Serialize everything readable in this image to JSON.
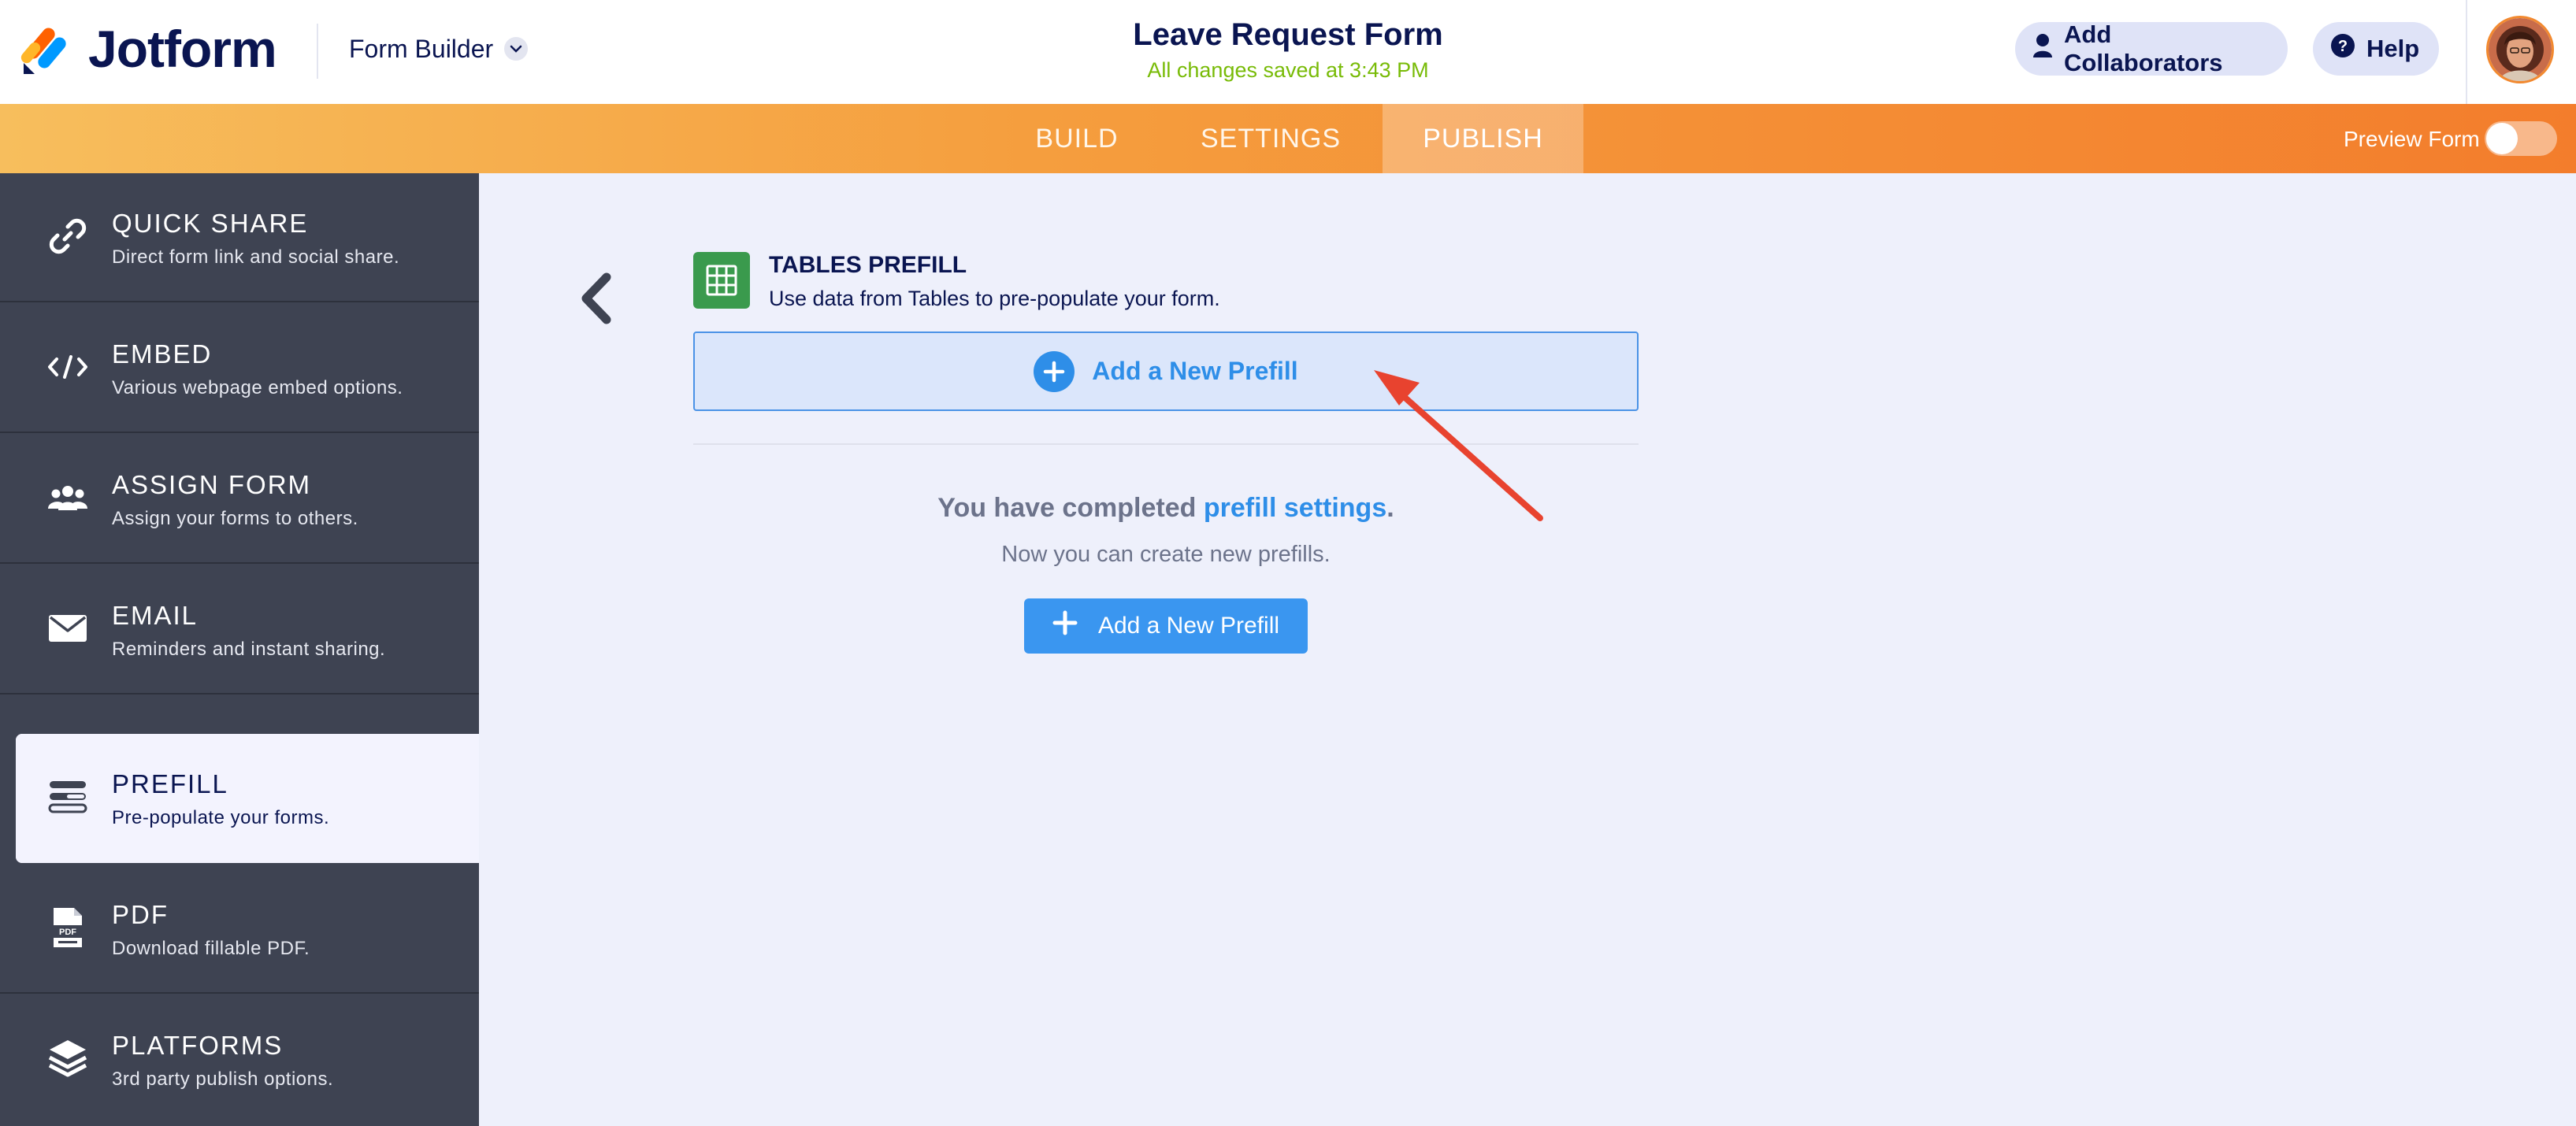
{
  "header": {
    "logo_text": "Jotform",
    "builder_label": "Form Builder",
    "form_title": "Leave Request Form",
    "save_status": "All changes saved at 3:43 PM",
    "add_collaborators_label": "Add Collaborators",
    "help_label": "Help"
  },
  "nav": {
    "tabs": [
      {
        "label": "BUILD"
      },
      {
        "label": "SETTINGS"
      },
      {
        "label": "PUBLISH",
        "active": true
      }
    ],
    "preview_label": "Preview Form",
    "preview_enabled": false
  },
  "sidebar": {
    "items": [
      {
        "title": "QUICK SHARE",
        "desc": "Direct form link and social share.",
        "icon": "link-icon"
      },
      {
        "title": "EMBED",
        "desc": "Various webpage embed options.",
        "icon": "code-icon"
      },
      {
        "title": "ASSIGN FORM",
        "desc": "Assign your forms to others.",
        "icon": "users-icon"
      },
      {
        "title": "EMAIL",
        "desc": "Reminders and instant sharing.",
        "icon": "envelope-icon"
      },
      {
        "title": "PREFILL",
        "desc": "Pre-populate your forms.",
        "icon": "prefill-icon",
        "active": true
      },
      {
        "title": "PDF",
        "desc": "Download fillable PDF.",
        "icon": "pdf-icon"
      },
      {
        "title": "PLATFORMS",
        "desc": "3rd party publish options.",
        "icon": "layers-icon"
      }
    ]
  },
  "main": {
    "section_title": "TABLES PREFILL",
    "section_desc": "Use data from Tables to pre-populate your form.",
    "add_prefill_box_label": "Add a New Prefill",
    "completed_prefix": "You have completed ",
    "completed_link": "prefill settings",
    "completed_suffix": ".",
    "now_text": "Now you can create new prefills.",
    "add_prefill_button_label": "Add a New Prefill"
  },
  "colors": {
    "accent_blue": "#2e8ee8",
    "orange_nav_start": "#f7be5d",
    "orange_nav_end": "#f37d2c",
    "sidebar_bg": "#3e4352",
    "saved_green": "#78bb07",
    "annotation_arrow": "#e8432f"
  }
}
